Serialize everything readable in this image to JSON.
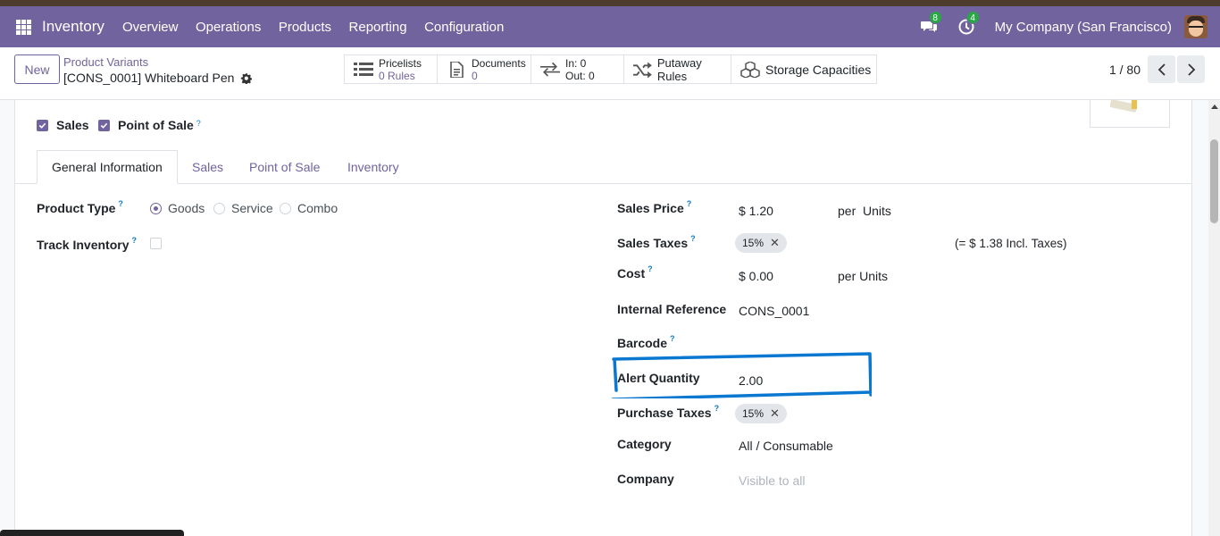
{
  "navbar": {
    "app_name": "Inventory",
    "menu": [
      "Overview",
      "Operations",
      "Products",
      "Reporting",
      "Configuration"
    ],
    "messages_count": "8",
    "activities_count": "4",
    "company": "My Company (San Francisco)"
  },
  "control_panel": {
    "new_label": "New",
    "breadcrumb_parent": "Product Variants",
    "breadcrumb_current": "[CONS_0001] Whiteboard Pen",
    "smart_buttons": {
      "pricelists_label": "Pricelists",
      "pricelists_value": "0 Rules",
      "documents_label": "Documents",
      "documents_value": "0",
      "in_text": "In: 0",
      "out_text": "Out: 0",
      "putaway_label": "Putaway Rules",
      "storage_label": "Storage Capacities"
    },
    "pager": "1 / 80"
  },
  "options": {
    "sales_label": "Sales",
    "pos_label": "Point of Sale",
    "sales_checked": true,
    "pos_checked": true
  },
  "tabs": [
    "General Information",
    "Sales",
    "Point of Sale",
    "Inventory"
  ],
  "left_fields": {
    "product_type_label": "Product Type",
    "product_type_options": [
      "Goods",
      "Service",
      "Combo"
    ],
    "product_type_selected": "Goods",
    "track_inventory_label": "Track Inventory"
  },
  "right_fields": {
    "sales_price_label": "Sales Price",
    "sales_price_value": "$ 1.20",
    "sales_price_unit": "per  Units",
    "sales_taxes_label": "Sales Taxes",
    "sales_taxes_tag": "15%",
    "sales_taxes_incl": "(= $ 1.38 Incl. Taxes)",
    "cost_label": "Cost",
    "cost_value": "$ 0.00",
    "cost_unit": "per Units",
    "internal_ref_label": "Internal Reference",
    "internal_ref_value": "CONS_0001",
    "barcode_label": "Barcode",
    "alert_qty_label": "Alert Quantity",
    "alert_qty_value": "2.00",
    "purchase_taxes_label": "Purchase Taxes",
    "purchase_taxes_tag": "15%",
    "category_label": "Category",
    "category_value": "All / Consumable",
    "company_label": "Company",
    "company_placeholder": "Visible to all"
  },
  "colors": {
    "brand": "#71639e",
    "highlight": "#0a78d1"
  }
}
